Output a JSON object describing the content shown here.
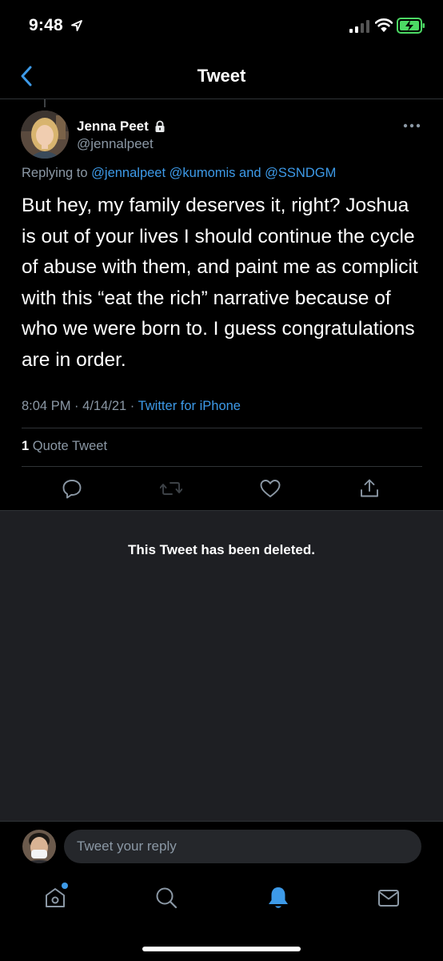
{
  "status_bar": {
    "time": "9:48",
    "icons": [
      "location-arrow-icon",
      "cellular-signal-icon",
      "wifi-icon",
      "battery-charging-icon"
    ],
    "battery_color": "#4cd964"
  },
  "nav": {
    "title": "Tweet",
    "back_icon": "chevron-left-icon",
    "accent_color": "#3d9ae8"
  },
  "tweet": {
    "author": {
      "name": "Jenna Peet",
      "handle": "@jennalpeet",
      "protected": true,
      "lock_icon": "lock-icon"
    },
    "more_icon": "more-horizontal-icon",
    "replying": {
      "prefix": "Replying to",
      "user1": "@jennalpeet",
      "user2": "@kumomis",
      "conj": "and",
      "user3": "@SSNDGM"
    },
    "text": "But hey, my family deserves it, right? Joshua is out of your lives I should continue the cycle of abuse with them, and paint me as complicit with this “eat the rich” narrative because of who we were born to. I guess congratulations are in order.",
    "time": "8:04 PM",
    "sep1": "·",
    "date": "4/14/21",
    "sep2": "·",
    "source": "Twitter for iPhone",
    "quote_count": "1",
    "quote_label": "Quote Tweet",
    "actions": [
      "reply-icon",
      "retweet-icon",
      "like-icon",
      "share-icon"
    ]
  },
  "deleted": {
    "message": "This Tweet has been deleted."
  },
  "reply_bar": {
    "placeholder": "Tweet your reply"
  },
  "tab_bar": {
    "tabs": [
      "home-icon",
      "search-icon",
      "notifications-bell-icon",
      "messages-mail-icon"
    ],
    "active": "notifications-bell-icon",
    "home_has_new": true
  }
}
